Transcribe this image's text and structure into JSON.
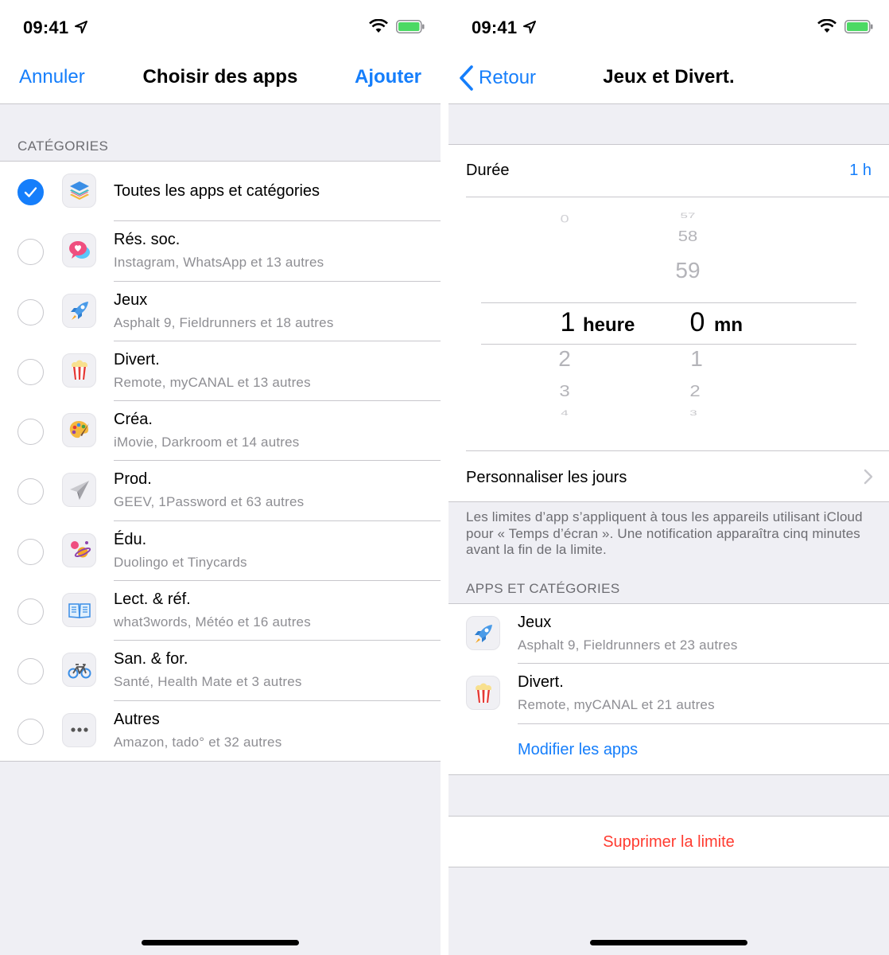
{
  "status_bar": {
    "time": "09:41"
  },
  "left_screen": {
    "nav": {
      "cancel": "Annuler",
      "title": "Choisir des apps",
      "add": "Ajouter"
    },
    "section_header": "CATÉGORIES",
    "items": [
      {
        "title": "Toutes les apps et catégories",
        "subtitle": "",
        "checked": true,
        "icon": "layers-icon"
      },
      {
        "title": "Rés. soc.",
        "subtitle": "Instagram, WhatsApp et 13 autres",
        "checked": false,
        "icon": "social-bubble-icon"
      },
      {
        "title": "Jeux",
        "subtitle": "Asphalt 9, Fieldrunners et 18 autres",
        "checked": false,
        "icon": "rocket-icon"
      },
      {
        "title": "Divert.",
        "subtitle": "Remote, myCANAL et 13 autres",
        "checked": false,
        "icon": "popcorn-icon"
      },
      {
        "title": "Créa.",
        "subtitle": "iMovie, Darkroom et 14 autres",
        "checked": false,
        "icon": "palette-icon"
      },
      {
        "title": "Prod.",
        "subtitle": "GEEV, 1Password et 63 autres",
        "checked": false,
        "icon": "paper-plane-icon"
      },
      {
        "title": "Édu.",
        "subtitle": "Duolingo et Tinycards",
        "checked": false,
        "icon": "planet-icon"
      },
      {
        "title": "Lect. & réf.",
        "subtitle": "what3words, Météo et 16 autres",
        "checked": false,
        "icon": "book-icon"
      },
      {
        "title": "San. & for.",
        "subtitle": "Santé, Health Mate et 3 autres",
        "checked": false,
        "icon": "bicycle-icon"
      },
      {
        "title": "Autres",
        "subtitle": "Amazon, tado° et 32 autres",
        "checked": false,
        "icon": "ellipsis-icon"
      }
    ]
  },
  "right_screen": {
    "nav": {
      "back": "Retour",
      "title": "Jeux et Divert."
    },
    "duration": {
      "label": "Durée",
      "value": "1 h"
    },
    "picker": {
      "hours_above": [
        "0"
      ],
      "hours_selected": "1",
      "hours_below": [
        "2",
        "3",
        "4"
      ],
      "hours_unit": "heure",
      "minutes_above": [
        "57",
        "58",
        "59"
      ],
      "minutes_selected": "0",
      "minutes_below": [
        "1",
        "2",
        "3"
      ],
      "minutes_unit": "mn"
    },
    "customize_days": "Personnaliser les jours",
    "footnote": "Les limites d’app s’appliquent à tous les appareils utilisant iCloud pour « Temps d’écran ». Une notification apparaîtra cinq minutes avant la fin de la limite.",
    "apps_section_header": "APPS ET CATÉGORIES",
    "apps": [
      {
        "title": "Jeux",
        "subtitle": "Asphalt 9, Fieldrunners et 23 autres",
        "icon": "rocket-icon"
      },
      {
        "title": "Divert.",
        "subtitle": "Remote, myCANAL et 21 autres",
        "icon": "popcorn-icon"
      }
    ],
    "modify_apps": "Modifier les apps",
    "delete_limit": "Supprimer la limite"
  },
  "colors": {
    "accent": "#157efb",
    "destructive": "#ff3b30",
    "background": "#efeff4",
    "separator": "#c8c7cc"
  }
}
